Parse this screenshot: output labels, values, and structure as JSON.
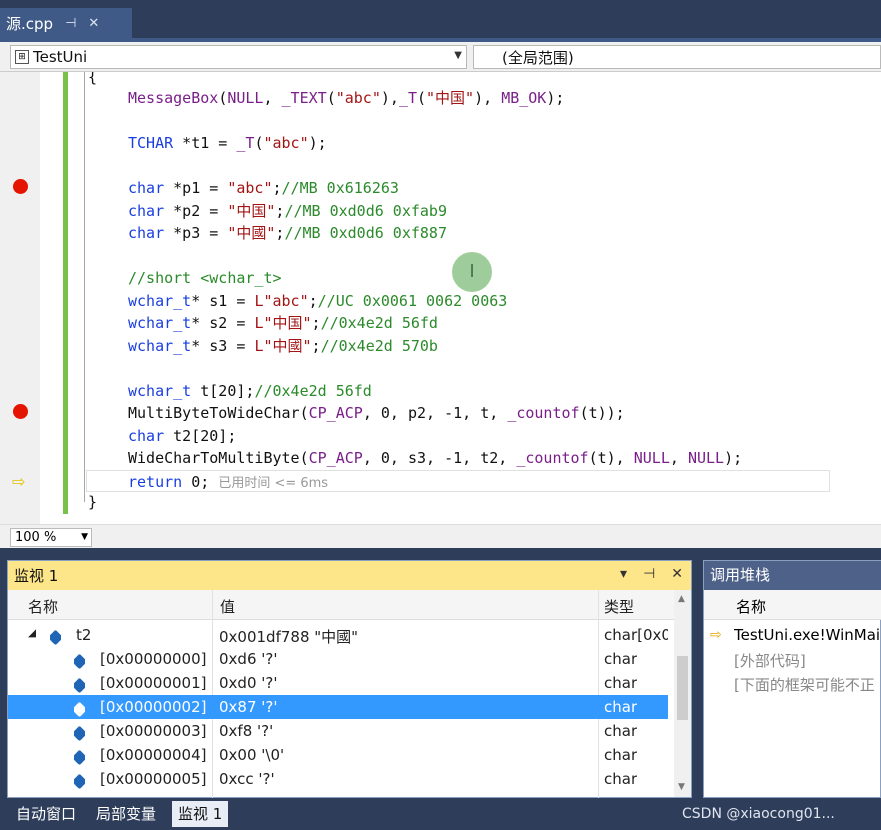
{
  "tab": {
    "title": "源.cpp",
    "pin": "⊣",
    "close": "✕"
  },
  "nav": {
    "project": "TestUni",
    "scope": "(全局范围)"
  },
  "editor": {
    "top_brace": "{",
    "lines": [
      {
        "t": "MessageBox(NULL, _TEXT(\"abc\"),_T(\"中国\"), MB_OK);"
      },
      {
        "t": "TCHAR *t1 = _T(\"abc\");"
      },
      {
        "t": "char *p1 = \"abc\";//MB 0x616263"
      },
      {
        "t": "char *p2 = \"中国\";//MB 0xd0d6 0xfab9"
      },
      {
        "t": "char *p3 = \"中國\";//MB 0xd0d6 0xf887"
      },
      {
        "t": "//short <wchar_t>"
      },
      {
        "t": "wchar_t* s1 = L\"abc\";//UC 0x0061 0062 0063"
      },
      {
        "t": "wchar_t* s2 = L\"中国\";//0x4e2d 56fd"
      },
      {
        "t": "wchar_t* s3 = L\"中國\";//0x4e2d 570b"
      },
      {
        "t": "wchar_t t[20];//0x4e2d 56fd"
      },
      {
        "t": "MultiByteToWideChar(CP_ACP, 0, p2, -1, t, _countof(t));"
      },
      {
        "t": "char t2[20];"
      },
      {
        "t": "WideCharToMultiByte(CP_ACP, 0, s3, -1, t2, _countof(t), NULL, NULL);"
      },
      {
        "t": "return 0;"
      }
    ],
    "perf_hint": "已用时间 <= 6ms",
    "close_brace": "}",
    "cursor_glyph": "I"
  },
  "zoom": {
    "value": "100 %"
  },
  "watch": {
    "title": "监视 1",
    "buttons": [
      "▾",
      "⊣",
      "✕"
    ],
    "headers": {
      "name": "名称",
      "value": "值",
      "type": "类型"
    },
    "rows": [
      {
        "name": "t2",
        "value": "0x001df788 \"中國\"",
        "type": "char[0x0"
      },
      {
        "name": "[0x00000000]",
        "value": "0xd6 '?'",
        "type": "char"
      },
      {
        "name": "[0x00000001]",
        "value": "0xd0 '?'",
        "type": "char"
      },
      {
        "name": "[0x00000002]",
        "value": "0x87 '?'",
        "type": "char"
      },
      {
        "name": "[0x00000003]",
        "value": "0xf8 '?'",
        "type": "char"
      },
      {
        "name": "[0x00000004]",
        "value": "0x00 '\\0'",
        "type": "char"
      },
      {
        "name": "[0x00000005]",
        "value": "0xcc '?'",
        "type": "char"
      }
    ]
  },
  "callstack": {
    "title": "调用堆栈",
    "header": "名称",
    "rows": [
      "TestUni.exe!WinMai",
      "[外部代码]",
      "[下面的框架可能不正"
    ]
  },
  "bottom_tabs": [
    "自动窗口",
    "局部变量",
    "监视 1"
  ],
  "watermark": "CSDN @xiaocong01..."
}
